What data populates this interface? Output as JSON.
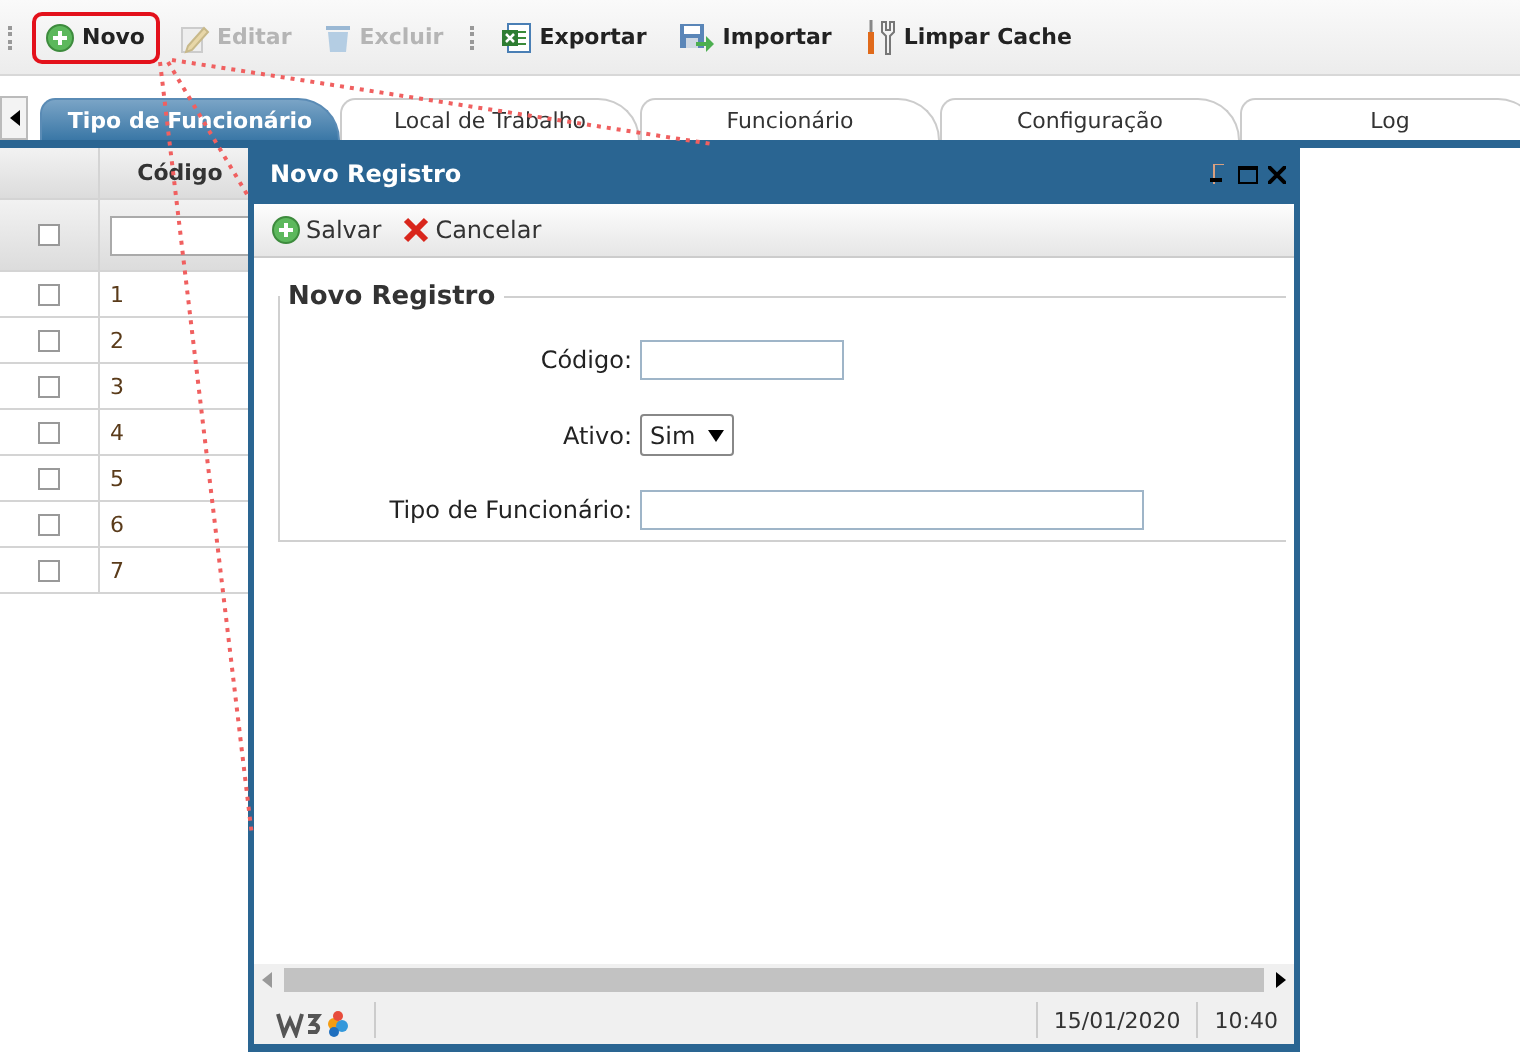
{
  "toolbar": {
    "buttons": [
      {
        "label": "Novo",
        "kind": "add",
        "disabled": false,
        "highlighted": true
      },
      {
        "label": "Editar",
        "kind": "edit",
        "disabled": true,
        "highlighted": false
      },
      {
        "label": "Excluir",
        "kind": "delete",
        "disabled": true,
        "highlighted": false
      },
      {
        "label": "Exportar",
        "kind": "export",
        "disabled": false,
        "highlighted": false
      },
      {
        "label": "Importar",
        "kind": "import",
        "disabled": false,
        "highlighted": false
      },
      {
        "label": "Limpar Cache",
        "kind": "tools",
        "disabled": false,
        "highlighted": false
      }
    ]
  },
  "tabs": [
    {
      "label": "Tipo de Funcionário",
      "selected": true
    },
    {
      "label": "Local de Trabalho",
      "selected": false
    },
    {
      "label": "Funcionário",
      "selected": false
    },
    {
      "label": "Configuração",
      "selected": false
    },
    {
      "label": "Log",
      "selected": false
    }
  ],
  "grid": {
    "columns": [
      "Código"
    ],
    "select_all_checked": false,
    "rows": [
      {
        "code": "1",
        "checked": false
      },
      {
        "code": "2",
        "checked": false
      },
      {
        "code": "3",
        "checked": false
      },
      {
        "code": "4",
        "checked": false
      },
      {
        "code": "5",
        "checked": false
      },
      {
        "code": "6",
        "checked": false
      },
      {
        "code": "7",
        "checked": false
      }
    ]
  },
  "dialog": {
    "title": "Novo Registro",
    "buttons": [
      {
        "label": "Salvar",
        "kind": "save"
      },
      {
        "label": "Cancelar",
        "kind": "cancel"
      }
    ],
    "legend": "Novo Registro",
    "fields": [
      {
        "label": "Código:",
        "kind": "text"
      },
      {
        "label": "Ativo:",
        "kind": "select",
        "value": "Sim"
      },
      {
        "label": "Tipo de Funcionário:",
        "kind": "wide-text"
      }
    ],
    "status": {
      "date": "15/01/2020",
      "time": "10:40"
    }
  }
}
